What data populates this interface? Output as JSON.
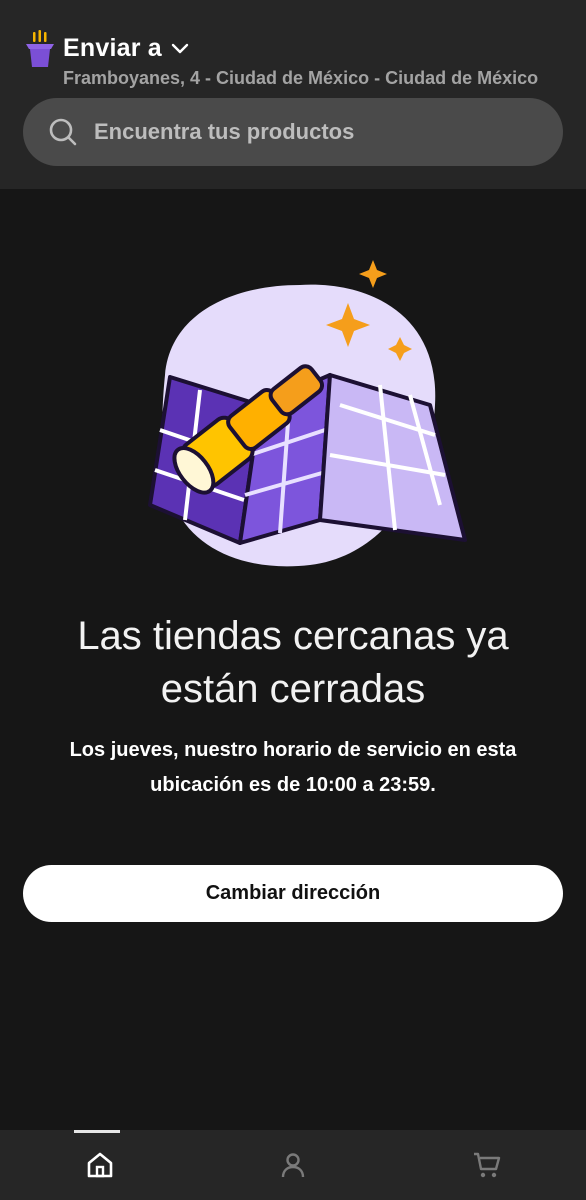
{
  "header": {
    "deliver_label": "Enviar a",
    "address": "Framboyanes, 4 - Ciudad de México - Ciudad de México"
  },
  "search": {
    "placeholder": "Encuentra tus productos",
    "icon": "search-icon"
  },
  "closed_state": {
    "illustration": "map-with-telescope-illustration",
    "title": "Las tiendas cercanas ya están cerradas",
    "message": "Los jueves, nuestro horario de servicio en esta ubicación es de 10:00 a 23:59.",
    "button_label": "Cambiar dirección"
  },
  "bottom_nav": {
    "items": [
      {
        "icon": "home-icon",
        "active": true
      },
      {
        "icon": "user-icon",
        "active": false
      },
      {
        "icon": "cart-icon",
        "active": false
      }
    ]
  },
  "colors": {
    "background": "#161616",
    "header": "#262626",
    "search_field": "#4a4a4a",
    "brand_purple": "#7b4fd6",
    "accent_orange": "#f59e1b",
    "button": "#ffffff"
  }
}
